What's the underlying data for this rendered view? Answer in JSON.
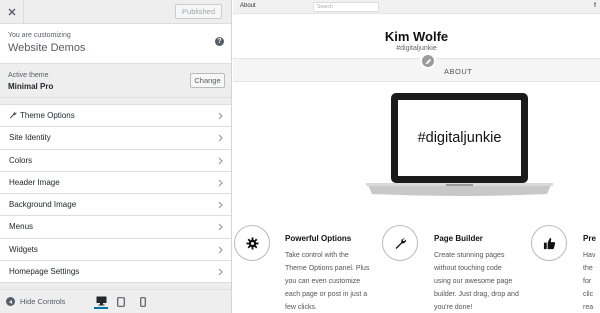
{
  "topbar": {
    "published_label": "Published"
  },
  "customizing": {
    "label": "You are customizing",
    "site": "Website Demos"
  },
  "theme": {
    "label": "Active theme",
    "name": "Minimal Pro",
    "change_label": "Change"
  },
  "menu": {
    "items": [
      {
        "label": "Theme Options",
        "icon": "wrench-icon"
      },
      {
        "label": "Site Identity"
      },
      {
        "label": "Colors"
      },
      {
        "label": "Header Image"
      },
      {
        "label": "Background Image"
      },
      {
        "label": "Menus"
      },
      {
        "label": "Widgets"
      },
      {
        "label": "Homepage Settings"
      }
    ]
  },
  "footer": {
    "hide_controls_label": "Hide Controls",
    "devices": [
      "desktop-icon",
      "tablet-icon",
      "mobile-icon"
    ],
    "active_device": "desktop-icon"
  },
  "preview": {
    "adminbar": {
      "about": "About",
      "search_placeholder": "Search",
      "fb": "f"
    },
    "site_title": "Kim Wolfe",
    "tagline": "#digitaljunkie",
    "nav_about": "ABOUT",
    "laptop_screen_text": "#digitaljunkie",
    "features": [
      {
        "icon": "gear-icon",
        "title": "Powerful Options",
        "body": "Take control with the\nTheme Options panel. Plus\nyou can even customize\neach page or post in just a\nfew clicks."
      },
      {
        "icon": "wrench-icon",
        "title": "Page Builder",
        "body": "Create stunning pages\nwithout touching code\nusing our awesome page\nbuilder. Just drag, drop and\nyou're done!"
      },
      {
        "icon": "thumbs-up-icon",
        "title": "Pre",
        "body": "Hav\nthe\nfor\nclic\nrea"
      }
    ]
  },
  "colors": {
    "accent": "#0073aa",
    "sidebar_bg": "#eeeeee",
    "edit_icon_bg": "#9c9c9c"
  }
}
